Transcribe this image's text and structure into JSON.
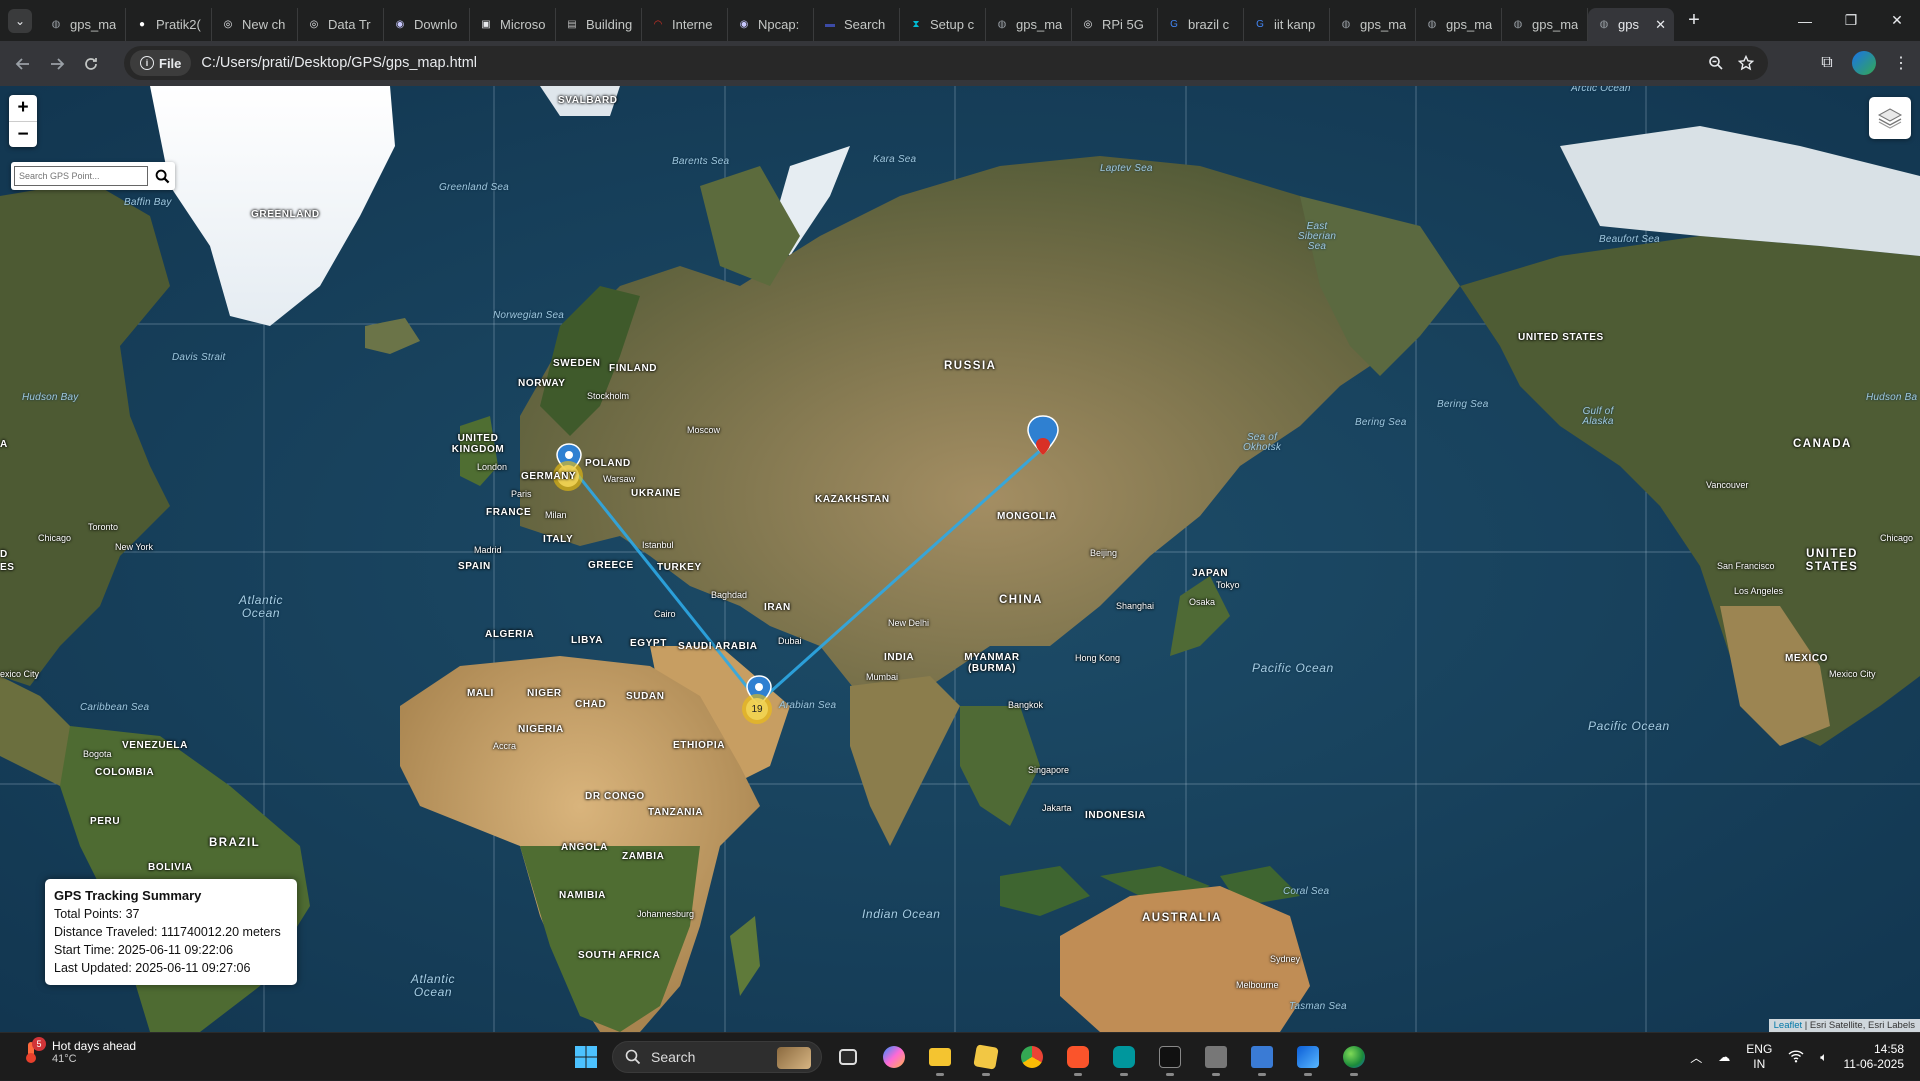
{
  "browser": {
    "tabs": [
      {
        "title": "gps_ma",
        "icon": "globe-icon",
        "color": "#9aa0a6"
      },
      {
        "title": "Pratik2(",
        "icon": "github-icon",
        "color": "#ffffff"
      },
      {
        "title": "New ch",
        "icon": "chatgpt-icon",
        "color": "#e8eaed"
      },
      {
        "title": "Data Tr",
        "icon": "chatgpt-icon",
        "color": "#e8eaed"
      },
      {
        "title": "Downlo",
        "icon": "eye-icon",
        "color": "#c8c8ff"
      },
      {
        "title": "Microso",
        "icon": "book-icon",
        "color": "#e8eaed"
      },
      {
        "title": "Building",
        "icon": "doc-icon",
        "color": "#bbbbbb"
      },
      {
        "title": "Interne",
        "icon": "arc-icon",
        "color": "#d93025"
      },
      {
        "title": "Npcap:",
        "icon": "eye-icon",
        "color": "#c8c8ff"
      },
      {
        "title": "Search",
        "icon": "search-site-icon",
        "color": "#3c4ba6"
      },
      {
        "title": "Setup c",
        "icon": "hourglass-icon",
        "color": "#00bcd4"
      },
      {
        "title": "gps_ma",
        "icon": "globe-icon",
        "color": "#9aa0a6"
      },
      {
        "title": "RPi 5G",
        "icon": "chatgpt-icon",
        "color": "#e8eaed"
      },
      {
        "title": "brazil c",
        "icon": "google-icon",
        "color": "#4285f4"
      },
      {
        "title": "iit kanp",
        "icon": "google-icon",
        "color": "#4285f4"
      },
      {
        "title": "gps_ma",
        "icon": "globe-icon",
        "color": "#9aa0a6"
      },
      {
        "title": "gps_ma",
        "icon": "globe-icon",
        "color": "#9aa0a6"
      },
      {
        "title": "gps_ma",
        "icon": "globe-icon",
        "color": "#9aa0a6"
      },
      {
        "title": "gps",
        "icon": "globe-icon",
        "color": "#9aa0a6",
        "active": true
      }
    ],
    "address_chip": "File",
    "url": "C:/Users/prati/Desktop/GPS/gps_map.html"
  },
  "map": {
    "zoom_in": "+",
    "zoom_out": "−",
    "search_placeholder": "Search GPS Point...",
    "summary": {
      "title": "GPS Tracking Summary",
      "total_points": "Total Points: 37",
      "distance": "Distance Traveled: 111740012.20 meters",
      "start_time": "Start Time: 2025-06-11 09:22:06",
      "last_updated": "Last Updated: 2025-06-11 09:27:06"
    },
    "clusters": [
      "17",
      "19"
    ],
    "attribution_link": "Leaflet",
    "attribution_text": " | Esri Satellite, Esri Labels",
    "labels": {
      "svalbard": "SVALBARD",
      "greenland": "GREENLAND",
      "sweden": "SWEDEN",
      "finland": "FINLAND",
      "norway": "NORWAY",
      "russia": "RUSSIA",
      "uk": "UNITED KINGDOM",
      "germany": "GERMANY",
      "poland": "POLAND",
      "ukraine": "UKRAINE",
      "france": "FRANCE",
      "italy": "ITALY",
      "spain": "SPAIN",
      "greece": "GREECE",
      "turkey": "TURKEY",
      "kazakhstan": "KAZAKHSTAN",
      "mongolia": "MONGOLIA",
      "china": "CHINA",
      "japan": "JAPAN",
      "iran": "IRAN",
      "saudi": "SAUDI ARABIA",
      "egypt": "EGYPT",
      "libya": "LIBYA",
      "algeria": "ALGERIA",
      "mali": "MALI",
      "niger": "NIGER",
      "chad": "CHAD",
      "sudan": "SUDAN",
      "ethiopia": "ETHIOPIA",
      "nigeria": "NIGERIA",
      "drc": "DR CONGO",
      "tanzania": "TANZANIA",
      "angola": "ANGOLA",
      "zambia": "ZAMBIA",
      "namibia": "NAMIBIA",
      "south_africa": "SOUTH AFRICA",
      "india": "INDIA",
      "myanmar": "MYANMAR (BURMA)",
      "indonesia": "INDONESIA",
      "australia": "AUSTRALIA",
      "united_states_top": "UNITED STATES",
      "canada": "CANADA",
      "united_states_right": "UNITED STATES",
      "mexico": "MEXICO",
      "venezuela": "VENEZUELA",
      "colombia": "COLOMBIA",
      "peru": "PERU",
      "brazil": "BRAZIL",
      "bolivia": "BOLIVIA",
      "arctic_ocean": "Arctic Ocean",
      "barents_sea": "Barents Sea",
      "kara_sea": "Kara Sea",
      "laptev_sea": "Laptev Sea",
      "east_siberian_sea": "East Siberian Sea",
      "beaufort_sea": "Beaufort Sea",
      "greenland_sea": "Greenland Sea",
      "baffin_bay": "Baffin Bay",
      "norwegian_sea": "Norwegian Sea",
      "davis_strait": "Davis Strait",
      "hudson_bay": "Hudson Bay",
      "hudson_bay_right": "Hudson Ba",
      "bering_sea": "Bering Sea",
      "bering_sea_2": "Bering Sea",
      "gulf_of_alaska": "Gulf of Alaska",
      "sea_of_okhotsk": "Sea of Okhotsk",
      "atlantic_ocean": "Atlantic Ocean",
      "atlantic_ocean_south": "Atlantic Ocean",
      "caribbean_sea": "Caribbean Sea",
      "arabian_sea": "Arabian Sea",
      "indian_ocean": "Indian Ocean",
      "pacific_ocean": "Pacific Ocean",
      "pacific_ocean_2": "Pacific Ocean",
      "coral_sea": "Coral Sea",
      "tasman_sea": "Tasman Sea",
      "stockholm": "Stockholm",
      "moscow": "Moscow",
      "london": "London",
      "paris": "Paris",
      "warsaw": "Warsaw",
      "milan": "Milan",
      "madrid": "Madrid",
      "istanbul": "Istanbul",
      "cairo": "Cairo",
      "baghdad": "Baghdad",
      "dubai": "Dubai",
      "new_delhi": "New Delhi",
      "mumbai": "Mumbai",
      "bangkok": "Bangkok",
      "hong_kong": "Hong Kong",
      "beijing": "Beijing",
      "shanghai": "Shanghai",
      "tokyo": "Tokyo",
      "osaka": "Osaka",
      "singapore": "Singapore",
      "jakarta": "Jakarta",
      "sydney": "Sydney",
      "melbourne": "Melbourne",
      "johannesburg": "Johannesburg",
      "accra": "Accra",
      "toronto": "Toronto",
      "new_york": "New York",
      "chicago": "Chicago",
      "chicago_right": "Chicago",
      "mexico_city": "exico City",
      "mexico_city_right": "Mexico City",
      "bogota": "Bogota",
      "vancouver": "Vancouver",
      "san_francisco": "San Francisco",
      "los_angeles": "Los Angeles",
      "edge_a": "A",
      "edge_d": "D",
      "edge_s": "ES"
    }
  },
  "taskbar": {
    "weather_title": "Hot days ahead",
    "weather_temp": "41°C",
    "weather_badge": "5",
    "search_label": "Search",
    "lang_line1": "ENG",
    "lang_line2": "IN",
    "time": "14:58",
    "date": "11-06-2025"
  }
}
